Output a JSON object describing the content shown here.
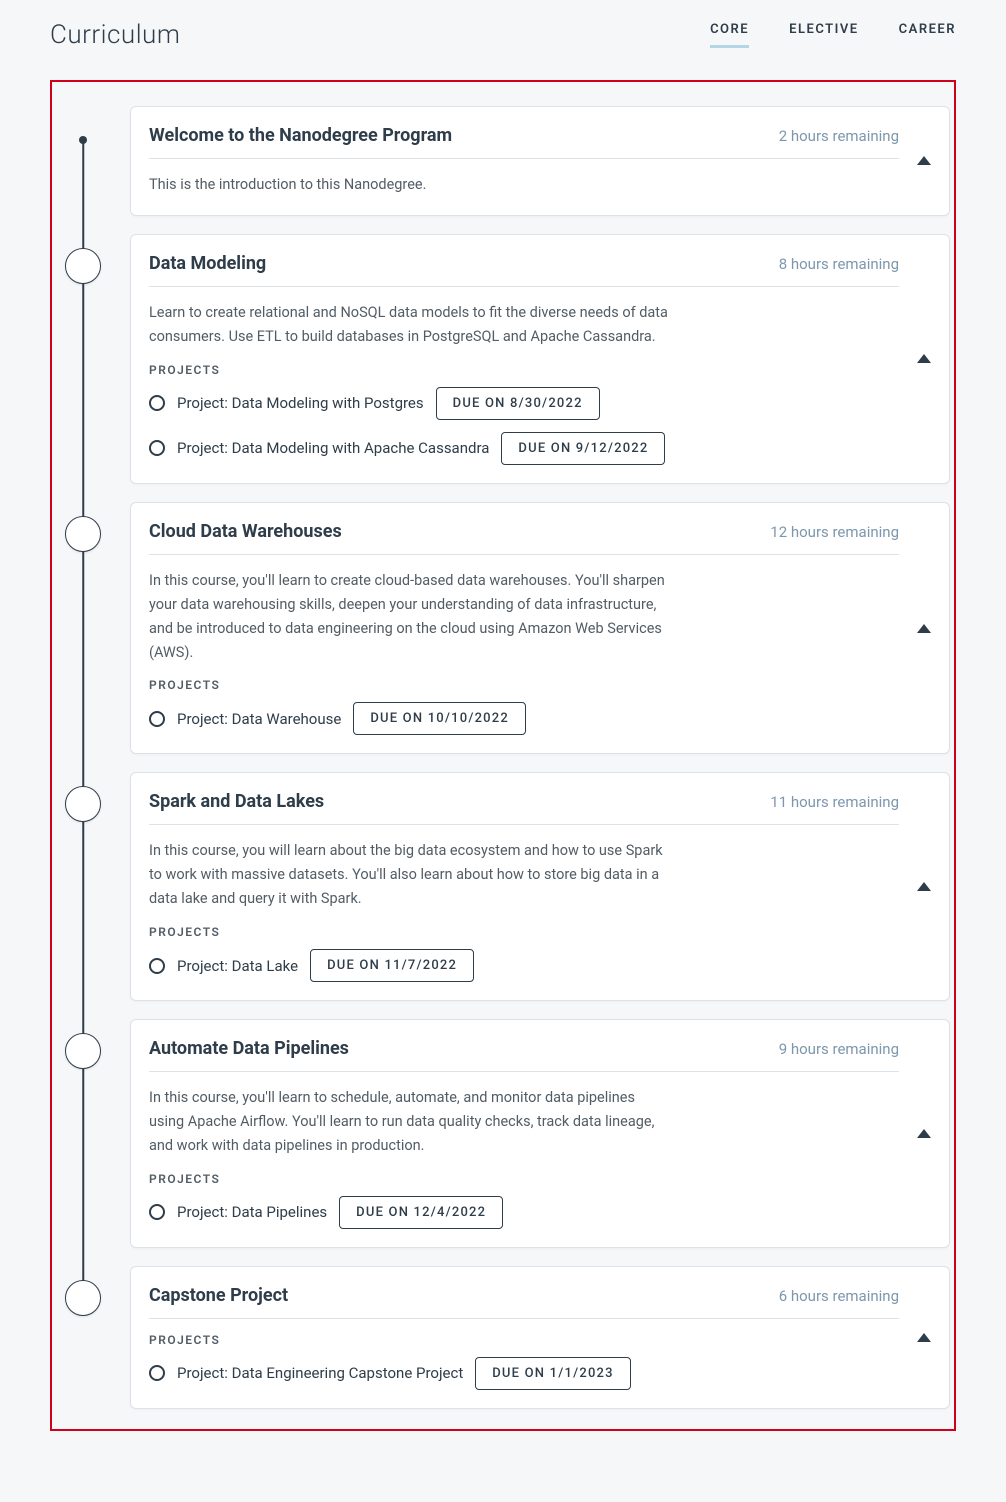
{
  "page_title": "Curriculum",
  "tabs": [
    {
      "label": "CORE",
      "active": true
    },
    {
      "label": "ELECTIVE",
      "active": false
    },
    {
      "label": "CAREER",
      "active": false
    }
  ],
  "projects_label": "PROJECTS",
  "courses": [
    {
      "title": "Welcome to the Nanodegree Program",
      "remaining": "2 hours remaining",
      "description": "This is the introduction to this Nanodegree.",
      "projects": []
    },
    {
      "title": "Data Modeling",
      "remaining": "8 hours remaining",
      "description": "Learn to create relational and NoSQL data models to fit the diverse needs of data consumers. Use ETL to build databases in PostgreSQL and Apache Cassandra.",
      "projects": [
        {
          "name": "Project: Data Modeling with Postgres",
          "due": "DUE ON 8/30/2022"
        },
        {
          "name": "Project: Data Modeling with Apache Cassandra",
          "due": "DUE ON 9/12/2022"
        }
      ]
    },
    {
      "title": "Cloud Data Warehouses",
      "remaining": "12 hours remaining",
      "description": "In this course, you'll learn to create cloud-based data warehouses. You'll sharpen your data warehousing skills, deepen your understanding of data infrastructure, and be introduced to data engineering on the cloud using Amazon Web Services (AWS).",
      "projects": [
        {
          "name": "Project: Data Warehouse",
          "due": "DUE ON 10/10/2022"
        }
      ]
    },
    {
      "title": "Spark and Data Lakes",
      "remaining": "11 hours remaining",
      "description": "In this course, you will learn about the big data ecosystem and how to use Spark to work with massive datasets. You'll also learn about how to store big data in a data lake and query it with Spark.",
      "projects": [
        {
          "name": "Project: Data Lake",
          "due": "DUE ON 11/7/2022"
        }
      ]
    },
    {
      "title": "Automate Data Pipelines",
      "remaining": "9 hours remaining",
      "description": "In this course, you'll learn to schedule, automate, and monitor data pipelines using Apache Airflow. You'll learn to run data quality checks, track data lineage, and work with data pipelines in production.",
      "projects": [
        {
          "name": "Project: Data Pipelines",
          "due": "DUE ON 12/4/2022"
        }
      ]
    },
    {
      "title": "Capstone Project",
      "remaining": "6 hours remaining",
      "description": "",
      "projects": [
        {
          "name": "Project: Data Engineering Capstone Project",
          "due": "DUE ON 1/1/2023"
        }
      ]
    }
  ]
}
